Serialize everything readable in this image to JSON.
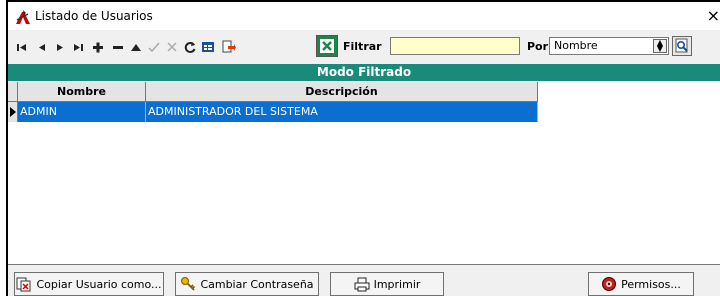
{
  "window": {
    "title": "Listado de Usuarios",
    "close_glyph": "×"
  },
  "toolbar": {
    "filter_label": "Filtrar",
    "filter_value": "",
    "sort_label": "Por",
    "sort_value": "Nombre",
    "buttons": [
      "first",
      "prior",
      "next",
      "last",
      "insert",
      "delete",
      "edit",
      "post",
      "cancel",
      "refresh",
      "grid-view",
      "export",
      "excel",
      "search"
    ]
  },
  "mode_bar": {
    "text": "Modo Filtrado"
  },
  "grid": {
    "columns": [
      "Nombre",
      "Descripción"
    ],
    "rows": [
      {
        "nombre": "ADMIN",
        "descripcion": "ADMINISTRADOR DEL SISTEMA"
      }
    ]
  },
  "buttons": {
    "copy_user": "Copiar Usuario como...",
    "change_password": "Cambiar Contraseña",
    "print": "Imprimir",
    "permissions": "Permisos..."
  },
  "colors": {
    "mode_bar": "#1a8a7a",
    "selected_row": "#0a6fd0",
    "filter_input": "#ffffcc"
  }
}
